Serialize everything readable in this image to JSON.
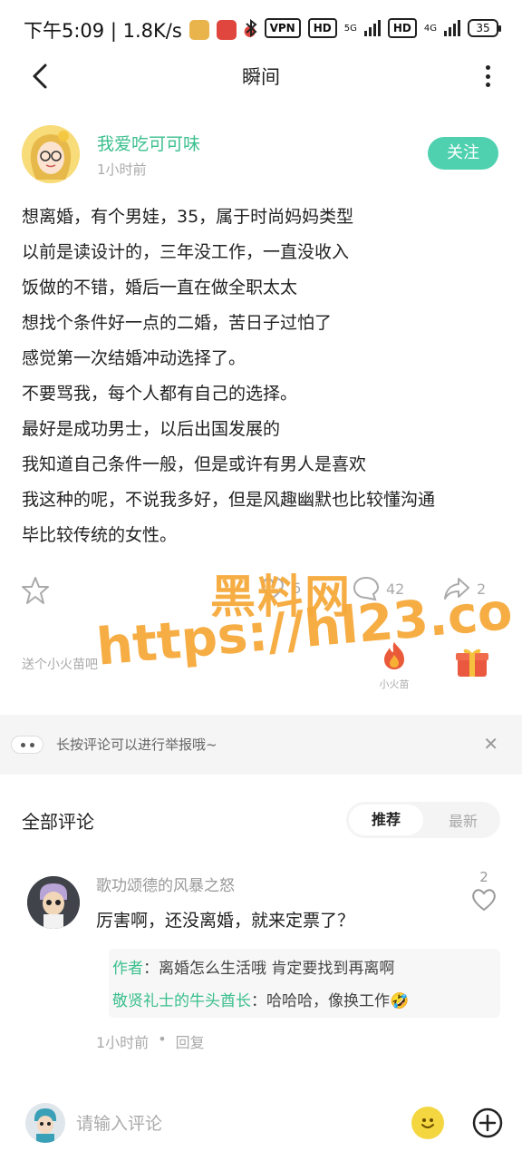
{
  "status_bar": {
    "time_speed": "下午5:09 | 1.8K/s",
    "vpn": "VPN",
    "hd": "HD",
    "net_5g": "5G",
    "net_4g": "4G",
    "battery": "35"
  },
  "nav": {
    "title": "瞬间"
  },
  "post": {
    "author": "我爱吃可可味",
    "time": "1小时前",
    "follow_label": "关注",
    "lines": [
      "想离婚，有个男娃，35，属于时尚妈妈类型",
      "以前是读设计的，三年没工作，一直没收入",
      "饭做的不错，婚后一直在做全职太太",
      "想找个条件好一点的二婚，苦日子过怕了",
      "感觉第一次结婚冲动选择了。",
      "不要骂我，每个人都有自己的选择。",
      "最好是成功男士，以后出国发展的",
      "我知道自己条件一般，但是或许有男人是喜欢",
      "我这种的呢，不说我多好，但是风趣幽默也比较懂沟通",
      "毕比较传统的女性。"
    ]
  },
  "actions": {
    "like_count": "6",
    "comment_count": "42",
    "share_count": "2"
  },
  "gift": {
    "text": "送个小火苗吧",
    "fire_label": "小火苗"
  },
  "tip": {
    "text": "长按评论可以进行举报哦~"
  },
  "comments_section": {
    "title": "全部评论",
    "tabs": [
      "推荐",
      "最新"
    ],
    "items": [
      {
        "user": "歌功颂德的风暴之怒",
        "text": "厉害啊，还没离婚，就来定票了？",
        "likes": "2",
        "replies": [
          {
            "name": "作者",
            "text": "离婚怎么生活哦 肯定要找到再离啊"
          },
          {
            "name": "敬贤礼士的牛头酋长",
            "text": "哈哈哈，像换工作🤣"
          }
        ],
        "time": "1小时前",
        "reply_label": "回复"
      }
    ]
  },
  "bottom": {
    "placeholder": "请输入评论"
  },
  "watermark": {
    "line1": "黑料网",
    "line2": "https://hl23.co"
  },
  "colors": {
    "accent": "#3bbf8e",
    "follow_bg": "#4fd1b0",
    "watermark": "#f6a93b"
  }
}
